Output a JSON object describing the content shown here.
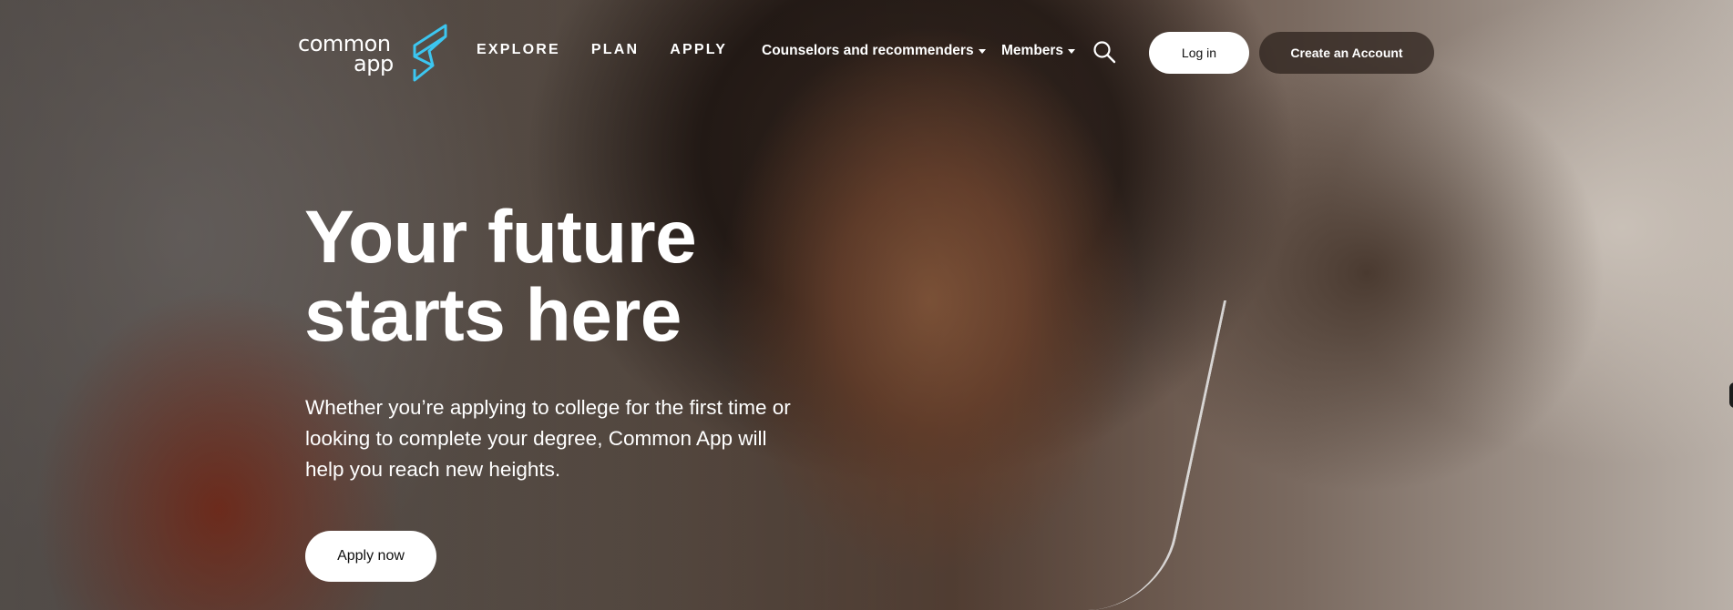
{
  "header": {
    "logo": {
      "line1": "common",
      "line2": "app",
      "mark_color": "#3cc6f0"
    },
    "nav_main": [
      "EXPLORE",
      "PLAN",
      "APPLY"
    ],
    "nav_dropdowns": {
      "counselors": "Counselors and recommenders",
      "members": "Members"
    },
    "search_icon": "search-icon",
    "login_label": "Log in",
    "create_account_label": "Create an Account"
  },
  "hero": {
    "title_line1": "Your future",
    "title_line2": "starts here",
    "subtitle_lines": [
      "Whether you’re applying to college for the first time or",
      "looking to complete your degree, Common App will",
      "help you reach new heights."
    ],
    "cta_label": "Apply now"
  }
}
